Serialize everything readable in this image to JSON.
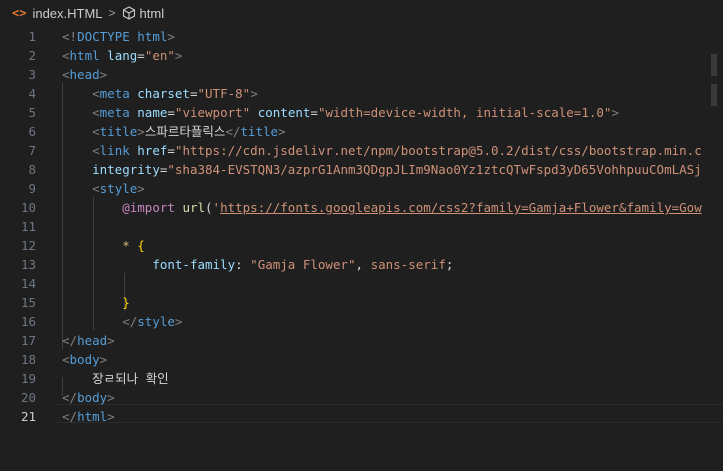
{
  "breadcrumb": {
    "file_icon": "<>",
    "file": "index.HTML",
    "separator": ">",
    "symbol_icon": "cube-icon",
    "symbol": "html"
  },
  "editor": {
    "active_line": "21",
    "lines": [
      {
        "n": "1",
        "t": "<!DOCTYPE html>"
      },
      {
        "n": "2",
        "t": "<html lang=\"en\">"
      },
      {
        "n": "3",
        "t": "<head>"
      },
      {
        "n": "4",
        "t": "    <meta charset=\"UTF-8\">"
      },
      {
        "n": "5",
        "t": "    <meta name=\"viewport\" content=\"width=device-width, initial-scale=1.0\">"
      },
      {
        "n": "6",
        "t": "    <title>스파르타플릭스</title>"
      },
      {
        "n": "7",
        "t": "    <link href=\"https://cdn.jsdelivr.net/npm/bootstrap@5.0.2/dist/css/bootstrap.min.c"
      },
      {
        "n": "8",
        "t": "    integrity=\"sha384-EVSTQN3/azprG1Anm3QDgpJLIm9Nao0Yz1ztcQTwFspd3yD65VohhpuuCOmLASj"
      },
      {
        "n": "9",
        "t": "    <style>"
      },
      {
        "n": "10",
        "t": "        @import url('https://fonts.googleapis.com/css2?family=Gamja+Flower&family=Gow"
      },
      {
        "n": "11",
        "t": ""
      },
      {
        "n": "12",
        "t": "        * {"
      },
      {
        "n": "13",
        "t": "            font-family: \"Gamja Flower\", sans-serif;"
      },
      {
        "n": "14",
        "t": ""
      },
      {
        "n": "15",
        "t": "        }"
      },
      {
        "n": "16",
        "t": "        </style>"
      },
      {
        "n": "17",
        "t": "</head>"
      },
      {
        "n": "18",
        "t": "<body>"
      },
      {
        "n": "19",
        "t": "    장ㄹ되나 확인"
      },
      {
        "n": "20",
        "t": "</body>"
      },
      {
        "n": "21",
        "t": "</html>"
      }
    ]
  }
}
